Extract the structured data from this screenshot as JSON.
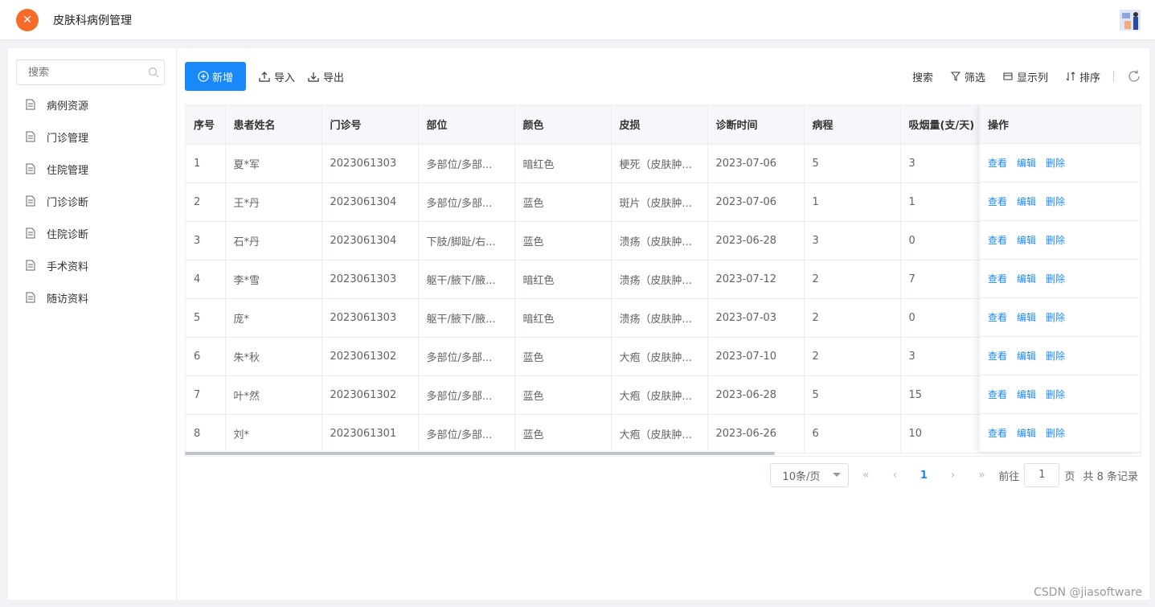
{
  "header": {
    "title": "皮肤科病例管理",
    "logo_icon": "wrench-icon"
  },
  "sidebar": {
    "search_placeholder": "搜索",
    "items": [
      {
        "label": "病例资源"
      },
      {
        "label": "门诊管理"
      },
      {
        "label": "住院管理"
      },
      {
        "label": "门诊诊断"
      },
      {
        "label": "住院诊断"
      },
      {
        "label": "手术资料"
      },
      {
        "label": "随访资料"
      }
    ]
  },
  "toolbar": {
    "add_label": "新增",
    "import_label": "导入",
    "export_label": "导出",
    "search_label": "搜索",
    "filter_label": "筛选",
    "columns_label": "显示列",
    "sort_label": "排序"
  },
  "table": {
    "headers": [
      "序号",
      "患者姓名",
      "门诊号",
      "部位",
      "颜色",
      "皮损",
      "诊断时间",
      "病程",
      "吸烟量(支/天)",
      "操作"
    ],
    "rows": [
      {
        "c": [
          "1",
          "夏*军",
          "2023061303",
          "多部位/多部...",
          "暗红色",
          "梗死（皮肤肿...",
          "2023-07-06",
          "5",
          "3"
        ]
      },
      {
        "c": [
          "2",
          "王*丹",
          "2023061304",
          "多部位/多部...",
          "蓝色",
          "斑片（皮肤肿...",
          "2023-07-06",
          "1",
          "1"
        ]
      },
      {
        "c": [
          "3",
          "石*丹",
          "2023061304",
          "下肢/脚趾/右...",
          "蓝色",
          "溃疡（皮肤肿...",
          "2023-06-28",
          "3",
          "0"
        ]
      },
      {
        "c": [
          "4",
          "李*雪",
          "2023061303",
          "躯干/腋下/腋...",
          "暗红色",
          "溃疡（皮肤肿...",
          "2023-07-12",
          "2",
          "7"
        ]
      },
      {
        "c": [
          "5",
          "庞*",
          "2023061303",
          "躯干/腋下/腋...",
          "暗红色",
          "溃疡（皮肤肿...",
          "2023-07-03",
          "2",
          "0"
        ]
      },
      {
        "c": [
          "6",
          "朱*秋",
          "2023061302",
          "多部位/多部...",
          "蓝色",
          "大疱（皮肤肿...",
          "2023-07-10",
          "2",
          "3"
        ]
      },
      {
        "c": [
          "7",
          "叶*然",
          "2023061302",
          "多部位/多部...",
          "蓝色",
          "大疱（皮肤肿...",
          "2023-06-28",
          "5",
          "15"
        ]
      },
      {
        "c": [
          "8",
          "刘*",
          "2023061301",
          "多部位/多部...",
          "蓝色",
          "大疱（皮肤肿...",
          "2023-06-26",
          "6",
          "10"
        ]
      }
    ],
    "actions": {
      "view": "查看",
      "edit": "编辑",
      "delete": "删除"
    }
  },
  "pagination": {
    "page_size": "10条/页",
    "current_page": "1",
    "goto_label": "前往",
    "goto_value": "1",
    "page_suffix": "页",
    "total_text": "共 8 条记录"
  },
  "watermark": "CSDN @jiasoftware",
  "colors": {
    "primary": "#1989fa",
    "logo": "#f56c2a"
  }
}
